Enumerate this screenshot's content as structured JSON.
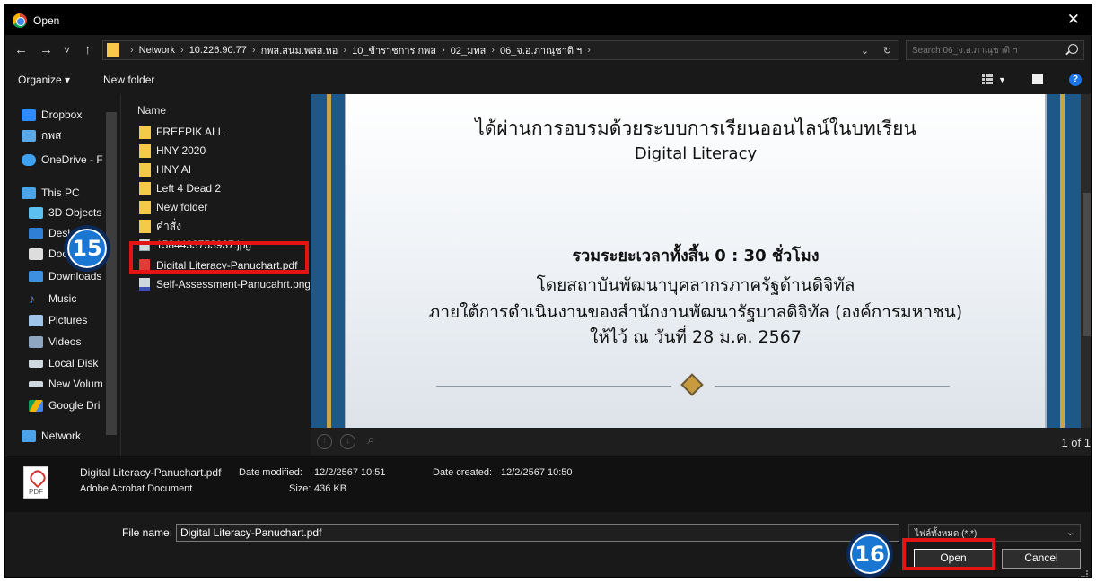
{
  "window": {
    "title": "Open",
    "close_glyph": "✕"
  },
  "nav": {
    "back": "←",
    "forward": "→",
    "recent": "˅",
    "up": "↑"
  },
  "address": {
    "crumbs": [
      "Network",
      "10.226.90.77",
      "กพส.สนม.พสส.หอ",
      "10_ข้าราชการ กพส",
      "02_มทส",
      "06_จ.อ.ภาณุชาติ ฯ"
    ],
    "dropdown_glyph": "⌄",
    "refresh_glyph": "↻"
  },
  "search": {
    "placeholder": "Search 06_จ.อ.ภาณุชาติ ฯ"
  },
  "toolbar": {
    "organize_label": "Organize ▾",
    "new_folder_label": "New folder"
  },
  "sidebar": {
    "items": [
      {
        "label": "Dropbox",
        "icon": "dropbox-icon"
      },
      {
        "label": "กพส",
        "icon": "folder-group-icon"
      },
      {
        "label": "OneDrive - F",
        "icon": "onedrive-icon"
      },
      {
        "label": "This PC",
        "icon": "computer-icon"
      },
      {
        "label": "3D Objects",
        "icon": "3d-objects-icon"
      },
      {
        "label": "Desktop",
        "icon": "desktop-icon"
      },
      {
        "label": "Documents",
        "icon": "documents-icon"
      },
      {
        "label": "Downloads",
        "icon": "downloads-icon"
      },
      {
        "label": "Music",
        "icon": "music-icon"
      },
      {
        "label": "Pictures",
        "icon": "pictures-icon"
      },
      {
        "label": "Videos",
        "icon": "videos-icon"
      },
      {
        "label": "Local Disk",
        "icon": "local-disk-icon"
      },
      {
        "label": "New Volum",
        "icon": "drive-icon"
      },
      {
        "label": "Google Dri",
        "icon": "google-drive-icon"
      },
      {
        "label": "Network",
        "icon": "network-icon"
      }
    ]
  },
  "filelist": {
    "column_name": "Name",
    "items": [
      {
        "label": "FREEPIK ALL",
        "type": "folder"
      },
      {
        "label": "HNY 2020",
        "type": "folder"
      },
      {
        "label": "HNY AI",
        "type": "folder"
      },
      {
        "label": "Left 4 Dead 2",
        "type": "folder"
      },
      {
        "label": "New folder",
        "type": "folder"
      },
      {
        "label": "คำสั่ง",
        "type": "folder"
      },
      {
        "label": "1584433753937.jpg",
        "type": "image"
      },
      {
        "label": "Digital Literacy-Panuchart.pdf",
        "type": "pdf"
      },
      {
        "label": "Self-Assessment-Panucahrt.png",
        "type": "png"
      }
    ]
  },
  "preview": {
    "line1": "ได้ผ่านการอบรมด้วยระบบการเรียนออนไลน์ในบทเรียน",
    "line2": "Digital Literacy",
    "line3": "รวมระยะเวลาทั้งสิ้น 0 : 30 ชั่วโมง",
    "line4": "โดยสถาบันพัฒนาบุคลากรภาครัฐด้านดิจิทัล",
    "line5": "ภายใต้การดำเนินงานของสำนักงานพัฒนารัฐบาลดิจิทัล (องค์การมหาชน)",
    "line6": "ให้ไว้ ณ วันที่ 28 ม.ค. 2567",
    "page_count": "1 of 1"
  },
  "details": {
    "file_name": "Digital Literacy-Panuchart.pdf",
    "modified_label": "Date modified:",
    "modified_value": "12/2/2567 10:51",
    "created_label": "Date created:",
    "created_value": "12/2/2567 10:50",
    "file_type": "Adobe Acrobat Document",
    "size_label": "Size:",
    "size_value": "436 KB",
    "icon_label": "PDF"
  },
  "footer": {
    "file_name_label": "File name:",
    "file_name_value": "Digital Literacy-Panuchart.pdf",
    "file_type_value": "ไฟล์ทั้งหมด (*.*)",
    "open_label": "Open",
    "cancel_label": "Cancel"
  },
  "badges": {
    "step15": "15",
    "step16": "16"
  },
  "colors": {
    "highlight": "#e41414",
    "badge_fill": "#1976d2",
    "folder": "#f7c948"
  }
}
